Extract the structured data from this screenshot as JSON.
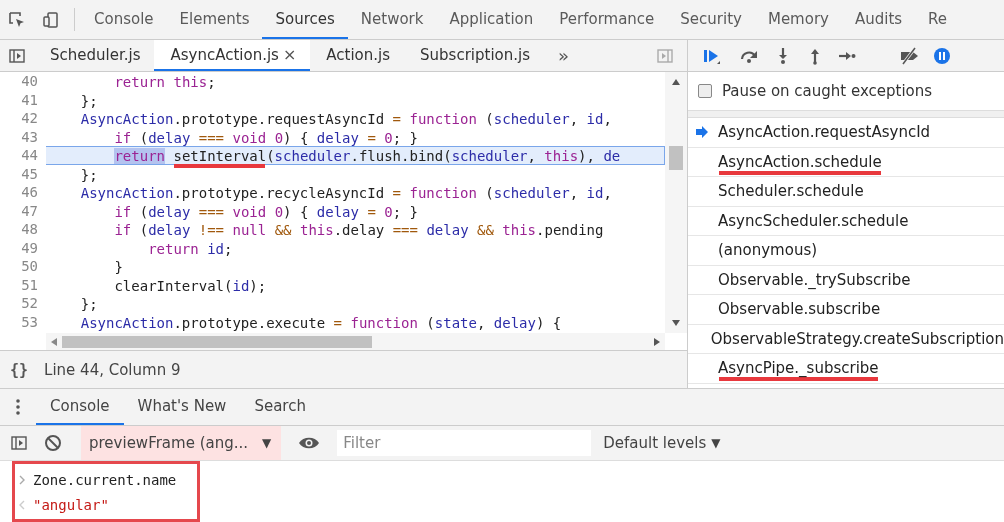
{
  "main_tabs": [
    {
      "label": "Console",
      "selected": false
    },
    {
      "label": "Elements",
      "selected": false
    },
    {
      "label": "Sources",
      "selected": true
    },
    {
      "label": "Network",
      "selected": false
    },
    {
      "label": "Application",
      "selected": false
    },
    {
      "label": "Performance",
      "selected": false
    },
    {
      "label": "Security",
      "selected": false
    },
    {
      "label": "Memory",
      "selected": false
    },
    {
      "label": "Audits",
      "selected": false
    },
    {
      "label": "Re",
      "selected": false
    }
  ],
  "file_tabs": [
    {
      "label": "Scheduler.js",
      "selected": false,
      "closable": false
    },
    {
      "label": "AsyncAction.js",
      "selected": true,
      "closable": true
    },
    {
      "label": "Action.js",
      "selected": false,
      "closable": false
    },
    {
      "label": "Subscription.js",
      "selected": false,
      "closable": false
    }
  ],
  "file_tabs_overflow": "»",
  "close_glyph": "×",
  "editor": {
    "lines": [
      {
        "number": "40",
        "highlighted": false,
        "tokens": [
          {
            "kind": "kw",
            "text": "        return"
          },
          {
            "kind": "kw",
            "text": " this"
          },
          {
            "kind": "plain",
            "text": ";"
          }
        ]
      },
      {
        "number": "41",
        "highlighted": false,
        "tokens": [
          {
            "kind": "plain",
            "text": "    };"
          }
        ]
      },
      {
        "number": "42",
        "highlighted": false,
        "tokens": [
          {
            "kind": "var",
            "text": "    AsyncAction"
          },
          {
            "kind": "plain",
            "text": ".prototype.requestAsyncId"
          },
          {
            "kind": "op",
            "text": " ="
          },
          {
            "kind": "kw",
            "text": " function"
          },
          {
            "kind": "plain",
            "text": " ("
          },
          {
            "kind": "var",
            "text": "scheduler"
          },
          {
            "kind": "plain",
            "text": ","
          },
          {
            "kind": "var",
            "text": " id"
          },
          {
            "kind": "plain",
            "text": ","
          }
        ]
      },
      {
        "number": "43",
        "highlighted": false,
        "tokens": [
          {
            "kind": "kw",
            "text": "        if"
          },
          {
            "kind": "plain",
            "text": " ("
          },
          {
            "kind": "var",
            "text": "delay"
          },
          {
            "kind": "op",
            "text": " ==="
          },
          {
            "kind": "kw",
            "text": " void"
          },
          {
            "kind": "kw",
            "text": " 0"
          },
          {
            "kind": "plain",
            "text": ") {"
          },
          {
            "kind": "var",
            "text": " delay"
          },
          {
            "kind": "op",
            "text": " ="
          },
          {
            "kind": "kw",
            "text": " 0"
          },
          {
            "kind": "plain",
            "text": "; }"
          }
        ]
      },
      {
        "number": "44",
        "highlighted": true,
        "tokens": [
          {
            "kind": "selection",
            "text": "        return"
          },
          {
            "kind": "underlined",
            "text": " setInterval"
          },
          {
            "kind": "plain",
            "text": "("
          },
          {
            "kind": "var",
            "text": "scheduler"
          },
          {
            "kind": "plain",
            "text": ".flush.bind("
          },
          {
            "kind": "var",
            "text": "scheduler"
          },
          {
            "kind": "plain",
            "text": ","
          },
          {
            "kind": "kw",
            "text": " this"
          },
          {
            "kind": "plain",
            "text": "),"
          },
          {
            "kind": "var",
            "text": " de"
          }
        ]
      },
      {
        "number": "45",
        "highlighted": false,
        "tokens": [
          {
            "kind": "plain",
            "text": "    };"
          }
        ]
      },
      {
        "number": "46",
        "highlighted": false,
        "tokens": [
          {
            "kind": "var",
            "text": "    AsyncAction"
          },
          {
            "kind": "plain",
            "text": ".prototype.recycleAsyncId"
          },
          {
            "kind": "op",
            "text": " ="
          },
          {
            "kind": "kw",
            "text": " function"
          },
          {
            "kind": "plain",
            "text": " ("
          },
          {
            "kind": "var",
            "text": "scheduler"
          },
          {
            "kind": "plain",
            "text": ","
          },
          {
            "kind": "var",
            "text": " id"
          },
          {
            "kind": "plain",
            "text": ","
          }
        ]
      },
      {
        "number": "47",
        "highlighted": false,
        "tokens": [
          {
            "kind": "kw",
            "text": "        if"
          },
          {
            "kind": "plain",
            "text": " ("
          },
          {
            "kind": "var",
            "text": "delay"
          },
          {
            "kind": "op",
            "text": " ==="
          },
          {
            "kind": "kw",
            "text": " void"
          },
          {
            "kind": "kw",
            "text": " 0"
          },
          {
            "kind": "plain",
            "text": ") {"
          },
          {
            "kind": "var",
            "text": " delay"
          },
          {
            "kind": "op",
            "text": " ="
          },
          {
            "kind": "kw",
            "text": " 0"
          },
          {
            "kind": "plain",
            "text": "; }"
          }
        ]
      },
      {
        "number": "48",
        "highlighted": false,
        "tokens": [
          {
            "kind": "kw",
            "text": "        if"
          },
          {
            "kind": "plain",
            "text": " ("
          },
          {
            "kind": "var",
            "text": "delay"
          },
          {
            "kind": "op",
            "text": " !=="
          },
          {
            "kind": "kw",
            "text": " null"
          },
          {
            "kind": "op",
            "text": " &&"
          },
          {
            "kind": "kw",
            "text": " this"
          },
          {
            "kind": "plain",
            "text": ".delay"
          },
          {
            "kind": "op",
            "text": " ==="
          },
          {
            "kind": "var",
            "text": " delay"
          },
          {
            "kind": "op",
            "text": " &&"
          },
          {
            "kind": "kw",
            "text": " this"
          },
          {
            "kind": "plain",
            "text": ".pending"
          }
        ]
      },
      {
        "number": "49",
        "highlighted": false,
        "tokens": [
          {
            "kind": "kw",
            "text": "            return"
          },
          {
            "kind": "var",
            "text": " id"
          },
          {
            "kind": "plain",
            "text": ";"
          }
        ]
      },
      {
        "number": "50",
        "highlighted": false,
        "tokens": [
          {
            "kind": "plain",
            "text": "        }"
          }
        ]
      },
      {
        "number": "51",
        "highlighted": false,
        "tokens": [
          {
            "kind": "plain",
            "text": "        clearInterval("
          },
          {
            "kind": "var",
            "text": "id"
          },
          {
            "kind": "plain",
            "text": ");"
          }
        ]
      },
      {
        "number": "52",
        "highlighted": false,
        "tokens": [
          {
            "kind": "plain",
            "text": "    };"
          }
        ]
      },
      {
        "number": "53",
        "highlighted": false,
        "tokens": [
          {
            "kind": "var",
            "text": "    AsyncAction"
          },
          {
            "kind": "plain",
            "text": ".prototype.execute"
          },
          {
            "kind": "op",
            "text": " ="
          },
          {
            "kind": "kw",
            "text": " function"
          },
          {
            "kind": "plain",
            "text": " ("
          },
          {
            "kind": "var",
            "text": "state"
          },
          {
            "kind": "plain",
            "text": ","
          },
          {
            "kind": "var",
            "text": " delay"
          },
          {
            "kind": "plain",
            "text": ") {"
          }
        ]
      }
    ]
  },
  "status_bar": {
    "format_button": "{}",
    "position": "Line 44, Column 9"
  },
  "debugger": {
    "pause_on_caught": {
      "label": "Pause on caught exceptions",
      "checked": false
    },
    "call_stack": [
      {
        "name": "AsyncAction.requestAsyncId",
        "current": true,
        "underlined": false
      },
      {
        "name": "AsyncAction.schedule",
        "current": false,
        "underlined": true
      },
      {
        "name": "Scheduler.schedule",
        "current": false,
        "underlined": false
      },
      {
        "name": "AsyncScheduler.schedule",
        "current": false,
        "underlined": false
      },
      {
        "name": "(anonymous)",
        "current": false,
        "underlined": false
      },
      {
        "name": "Observable._trySubscribe",
        "current": false,
        "underlined": false
      },
      {
        "name": "Observable.subscribe",
        "current": false,
        "underlined": false
      },
      {
        "name": "ObservableStrategy.createSubscription",
        "current": false,
        "underlined": false
      },
      {
        "name": "AsyncPipe._subscribe",
        "current": false,
        "underlined": true
      }
    ]
  },
  "drawer": {
    "tabs": [
      {
        "label": "Console",
        "selected": true
      },
      {
        "label": "What's New",
        "selected": false
      },
      {
        "label": "Search",
        "selected": false
      }
    ],
    "context": "previewFrame (ang...",
    "context_caret": "▼",
    "filter_placeholder": "Filter",
    "levels": "Default levels",
    "levels_caret": "▼",
    "output": {
      "boxed": true,
      "entries": [
        {
          "kind": "input",
          "text": "Zone.current.name"
        },
        {
          "kind": "result",
          "text": "\"angular\""
        }
      ]
    }
  }
}
